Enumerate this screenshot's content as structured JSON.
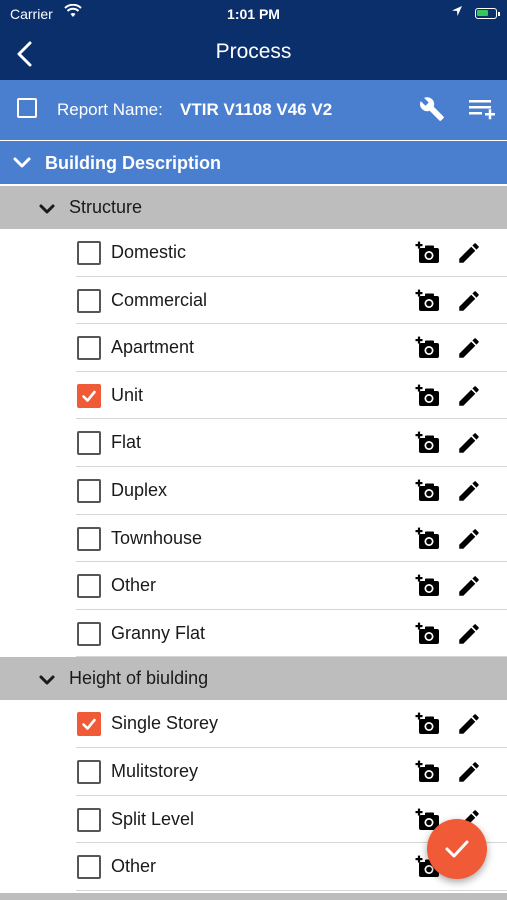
{
  "status": {
    "carrier": "Carrier",
    "time": "1:01 PM"
  },
  "nav": {
    "title": "Process"
  },
  "report": {
    "label": "Report Name:",
    "name": "VTIR V1108 V46 V2"
  },
  "section": {
    "title": "Building Description"
  },
  "groups": [
    {
      "title": "Structure",
      "items": [
        {
          "label": "Domestic",
          "checked": false
        },
        {
          "label": "Commercial",
          "checked": false
        },
        {
          "label": "Apartment",
          "checked": false
        },
        {
          "label": "Unit",
          "checked": true
        },
        {
          "label": "Flat",
          "checked": false
        },
        {
          "label": "Duplex",
          "checked": false
        },
        {
          "label": "Townhouse",
          "checked": false
        },
        {
          "label": "Other",
          "checked": false
        },
        {
          "label": "Granny Flat",
          "checked": false
        }
      ]
    },
    {
      "title": "Height of biulding",
      "items": [
        {
          "label": "Single Storey",
          "checked": true
        },
        {
          "label": "Mulitstorey",
          "checked": false
        },
        {
          "label": "Split Level",
          "checked": false
        },
        {
          "label": "Other",
          "checked": false
        }
      ]
    }
  ],
  "colors": {
    "navy": "#0a2f6b",
    "blue": "#4a7fd0",
    "accent": "#f05a36",
    "groupbg": "#bdbdbd"
  }
}
